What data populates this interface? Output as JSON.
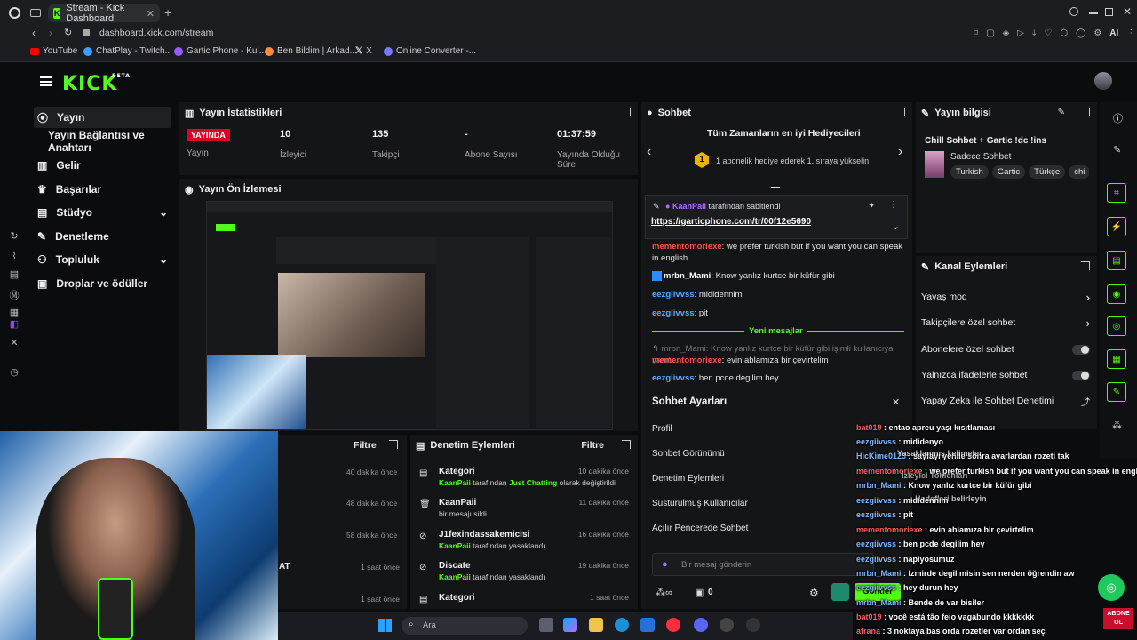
{
  "browser": {
    "tab_title": "Stream - Kick Dashboard",
    "url": "dashboard.kick.com/stream",
    "bookmarks": [
      "YouTube",
      "ChatPlay - Twitch...",
      "Gartic Phone - Kul...",
      "Ben Bildim | Arkad...",
      "X",
      "Online Converter -..."
    ],
    "ai_label": "AI"
  },
  "brand": {
    "logo": "KICK",
    "badge": "BETA"
  },
  "nav": {
    "items": [
      "Yayın",
      "Yayın Bağlantısı ve Anahtarı",
      "Gelir",
      "Başarılar",
      "Stüdyo",
      "Denetleme",
      "Topluluk",
      "Droplar ve ödüller"
    ]
  },
  "stats": {
    "title": "Yayın İstatistikleri",
    "status_badge": "YAYINDA",
    "status_label": "Yayın",
    "viewers_value": "10",
    "viewers_label": "İzleyici",
    "followers_value": "135",
    "followers_label": "Takipçi",
    "subs_value": "-",
    "subs_label": "Abone Sayısı",
    "uptime_value": "01:37:59",
    "uptime_label": "Yayında Olduğu Süre"
  },
  "preview": {
    "title": "Yayın Ön İzlemesi"
  },
  "chat": {
    "title": "Sohbet",
    "top_gifters_title": "Tüm Zamanların en iyi Hediyecileri",
    "rank_badge": "1",
    "top_gifters_text": "1 abonelik hediye ederek 1. sıraya yükselin",
    "pinned_by_user": "KaanPaii",
    "pinned_by_text": "tarafından sabitlendi",
    "pinned_link": "https://garticphone.com/tr/00f12e5690",
    "messages": [
      {
        "user": "mementomoriexe",
        "text": "we prefer turkish but if you want you can speak in english"
      },
      {
        "user": "mrbn_Mami",
        "text": "Know yanlız kurtce bir küfür gibi"
      },
      {
        "user": "eezgiivvss",
        "text": "mididennim"
      },
      {
        "user": "eezgiivvss",
        "text": "pit"
      }
    ],
    "new_messages_label": "Yeni mesajlar",
    "reply_preview": "mrbn_Mami: Know yanlız kurtce bir küfür gibi işimli kullanıcıya yanıt...",
    "messages_after": [
      {
        "user": "mementomoriexe",
        "text": "evin ablamıza bir çevirtelim"
      },
      {
        "user": "eezgiivvss",
        "text": "ben pcde degilim hey"
      }
    ],
    "settings_title": "Sohbet Ayarları",
    "settings_items": [
      "Profil",
      "Sohbet Görünümü",
      "Denetim Eylemleri",
      "Susturulmuş Kullanıcılar",
      "Açılır Pencerede Sohbet"
    ],
    "input_placeholder": "Bir mesaj gönderin",
    "points_count": "0",
    "send_label": "Gönder"
  },
  "stream_info": {
    "title": "Yayın bilgisi",
    "stream_title": "Chill Sohbet + Gartic !dc !ins",
    "category": "Sadece Sohbet",
    "tags": [
      "Turkish",
      "Gartic",
      "Türkçe",
      "chi"
    ]
  },
  "channel_actions": {
    "title": "Kanal Eylemleri",
    "items": [
      {
        "label": "Yavaş mod",
        "kind": "chevron"
      },
      {
        "label": "Takipçilere özel sohbet",
        "kind": "chevron"
      },
      {
        "label": "Abonelere özel sohbet",
        "kind": "toggle"
      },
      {
        "label": "Yalnızca ifadelerle sohbet",
        "kind": "toggle"
      },
      {
        "label": "Yapay Zeka ile Sohbet Denetimi",
        "kind": "external"
      }
    ]
  },
  "left_feed": {
    "filter_label": "Filtre",
    "times": [
      "40 dakika önce",
      "48 dakika önce",
      "58 dakika önce",
      "1 saat önce",
      "1 saat önce"
    ],
    "partial_text": "AT"
  },
  "mod_actions": {
    "title": "Denetim Eylemleri",
    "filter_label": "Filtre",
    "items": [
      {
        "title": "Kategori",
        "time": "10 dakika önce",
        "user": "KaanPaii",
        "mid": "tarafından",
        "highlight": "Just Chatting",
        "rest": "olarak değiştirildi"
      },
      {
        "title": "KaanPaii",
        "time": "11 dakika önce",
        "user": "",
        "mid": "bir mesajı sildi",
        "highlight": "",
        "rest": ""
      },
      {
        "title": "J1fexindassakemicisi",
        "time": "16 dakika önce",
        "user": "KaanPaii",
        "mid": "tarafından yasaklandı",
        "highlight": "",
        "rest": ""
      },
      {
        "title": "Discate",
        "time": "19 dakika önce",
        "user": "KaanPaii",
        "mid": "tarafından yasaklandı",
        "highlight": "",
        "rest": ""
      },
      {
        "title": "Kategori",
        "time": "1 saat önce",
        "user": "",
        "mid": "",
        "highlight": "",
        "rest": ""
      }
    ]
  },
  "overlay_chat": [
    {
      "user": "bat019",
      "text": "entao apreu"
    },
    {
      "user": "eezgiivvss",
      "text": "mididenyo"
    },
    {
      "user": "HicKime0123",
      "text": "sayfayı yenile sonra ayarlardan rozeti tak"
    },
    {
      "user": "mementomoriexe",
      "text": "we prefer turkish but if you want you can speak in english"
    },
    {
      "user": "mrbn_Mami",
      "text": "Know yanlız kurtce bir küfür gibi"
    },
    {
      "user": "eezgiivvss",
      "text": "mididennim"
    },
    {
      "user": "eezgiivvss",
      "text": "pit"
    },
    {
      "user": "mementomoriexe",
      "text": "evin ablamıza bir çevirtelim"
    },
    {
      "user": "eezgiivvss",
      "text": "ben pcde degilim hey"
    },
    {
      "user": "eezgiivvss",
      "text": "napiyosumuz"
    },
    {
      "user": "mrbn_Mami",
      "text": "Izmirde degil misin sen nerden öğrendin aw"
    },
    {
      "user": "eezgiivvss",
      "text": "hey durun hey"
    },
    {
      "user": "mrbn_Mami",
      "text": "Bende de var bisiler"
    },
    {
      "user": "bat019",
      "text": "você está tão feio vagabundo kkkkkkk"
    },
    {
      "user": "afrana",
      "text": "3 noktaya bas orda rozetler var ordan seç"
    }
  ],
  "overlay_fragments": [
    "yaşı kısıtlaması",
    "Yasaklanmış kelimeler",
    "İzleyici Tohlenları",
    "Hedefleri belirleyin"
  ],
  "taskbar": {
    "search_placeholder": "Ara",
    "corner_badge": "ABONE OL"
  }
}
